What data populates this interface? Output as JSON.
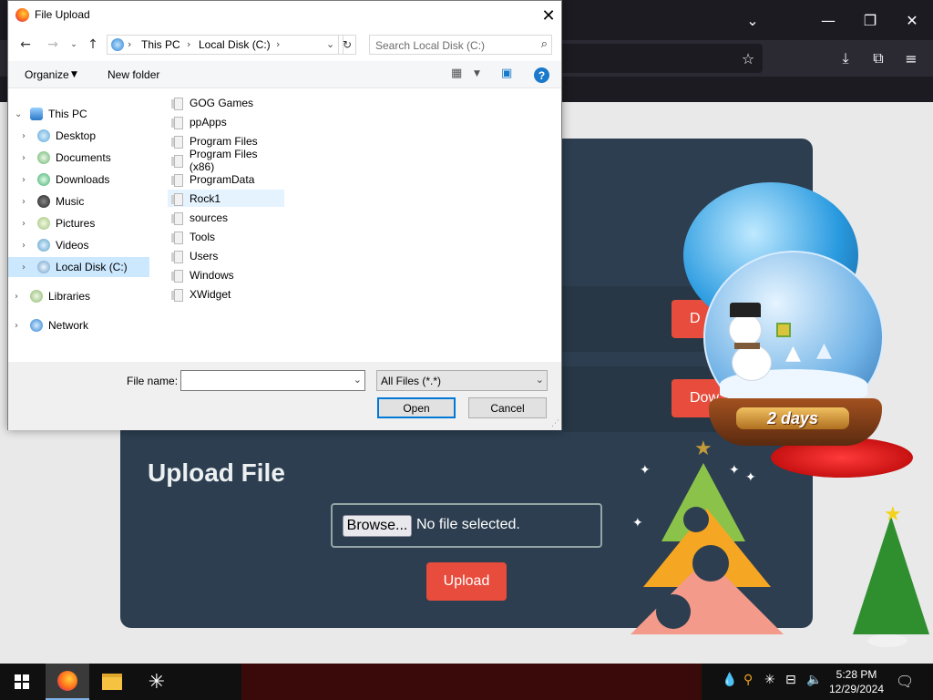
{
  "browser": {
    "icons": [
      "chevron-down-icon",
      "minimize-icon",
      "maximize-icon",
      "close-icon",
      "bookmark-star-icon",
      "download-icon",
      "extensions-icon",
      "menu-icon"
    ]
  },
  "page": {
    "partial_button_1": "D",
    "partial_button_2": "Dow",
    "upload_title": "Upload File",
    "browse_label": "Browse...",
    "no_file_text": "No file selected.",
    "upload_button": "Upload",
    "countdown": "2 days"
  },
  "dialog": {
    "title": "File Upload",
    "address": [
      "This PC",
      "Local Disk (C:)"
    ],
    "search_placeholder": "Search Local Disk (C:)",
    "organize_label": "Organize",
    "new_folder_label": "New folder",
    "nav_tree": [
      {
        "label": "This PC",
        "icon": "computer-icon"
      },
      {
        "label": "Desktop",
        "icon": "desktop-icon"
      },
      {
        "label": "Documents",
        "icon": "documents-icon"
      },
      {
        "label": "Downloads",
        "icon": "downloads-icon"
      },
      {
        "label": "Music",
        "icon": "music-icon"
      },
      {
        "label": "Pictures",
        "icon": "pictures-icon"
      },
      {
        "label": "Videos",
        "icon": "videos-icon"
      },
      {
        "label": "Local Disk (C:)",
        "icon": "disk-icon",
        "selected": true
      },
      {
        "label": "Libraries",
        "icon": "libraries-icon"
      },
      {
        "label": "Network",
        "icon": "network-icon"
      }
    ],
    "files": [
      "GOG Games",
      "ppApps",
      "Program Files",
      "Program Files (x86)",
      "ProgramData",
      "Rock1",
      "sources",
      "Tools",
      "Users",
      "Windows",
      "XWidget"
    ],
    "hovered_file": "Rock1",
    "file_name_label": "File name:",
    "file_name_value": "",
    "file_type": "All Files (*.*)",
    "open_label": "Open",
    "cancel_label": "Cancel"
  },
  "taskbar": {
    "time": "5:28 PM",
    "date": "12/29/2024",
    "apps": [
      "firefox-icon",
      "file-explorer-icon",
      "spark-icon"
    ]
  },
  "colors": {
    "panel": "#2c3e50",
    "accent_red": "#e74c3c",
    "selection": "#cce8ff",
    "primary_border": "#0078d7"
  }
}
